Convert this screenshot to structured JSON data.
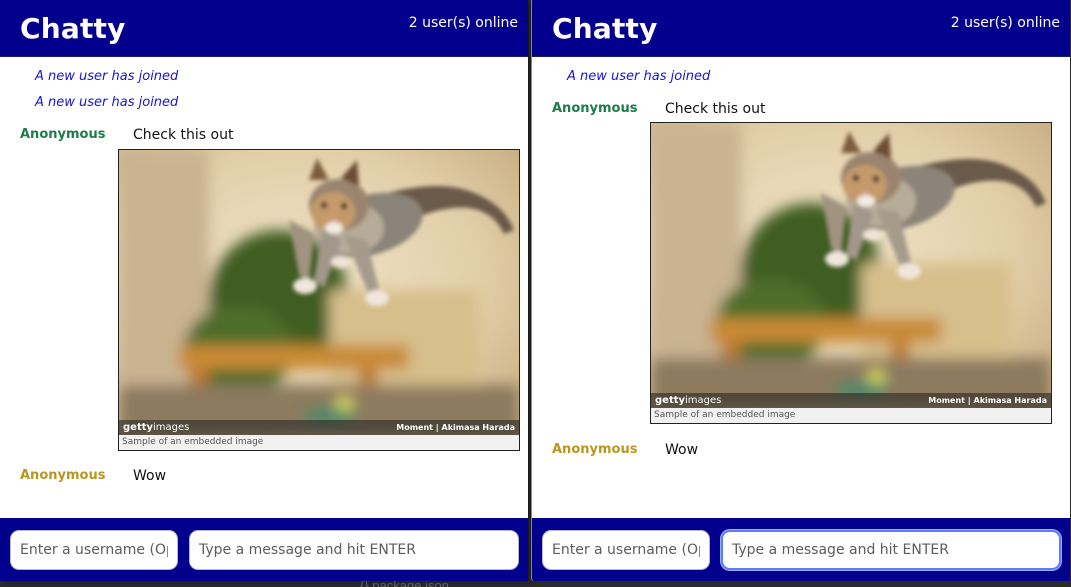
{
  "app": {
    "title": "Chatty",
    "online_text": "2 user(s) online"
  },
  "colors": {
    "header_bg": "#03008e",
    "notice_text": "#1a13d8",
    "user_green": "#1e7c4a",
    "user_gold": "#b8971e"
  },
  "windows": [
    {
      "messages": [
        {
          "kind": "notice",
          "text": "A new user has joined"
        },
        {
          "kind": "notice",
          "text": "A new user has joined"
        },
        {
          "kind": "chat",
          "user": "Anonymous",
          "user_color": "#1e7c4a",
          "text": "Check this out"
        },
        {
          "kind": "embed",
          "brand": "getty",
          "brand_suffix": "images",
          "credit": "Moment  |  Akimasa Harada",
          "caption": "Sample of an embedded image"
        },
        {
          "kind": "chat",
          "user": "Anonymous",
          "user_color": "#b8971e",
          "text": "Wow"
        }
      ],
      "composer": {
        "username_placeholder": "Enter a username (Optional)",
        "message_placeholder": "Type a message and hit ENTER"
      }
    },
    {
      "messages": [
        {
          "kind": "notice",
          "text": "A new user has joined"
        },
        {
          "kind": "chat",
          "user": "Anonymous",
          "user_color": "#1e7c4a",
          "text": "Check this out"
        },
        {
          "kind": "embed",
          "brand": "getty",
          "brand_suffix": "images",
          "credit": "Moment  |  Akimasa Harada",
          "caption": "Sample of an embedded image"
        },
        {
          "kind": "chat",
          "user": "Anonymous",
          "user_color": "#b8971e",
          "text": "Wow"
        }
      ],
      "composer": {
        "username_placeholder": "Enter a username (Optional)",
        "message_placeholder": "Type a message and hit ENTER"
      }
    }
  ],
  "background": {
    "peek_text": "{} package.json"
  }
}
